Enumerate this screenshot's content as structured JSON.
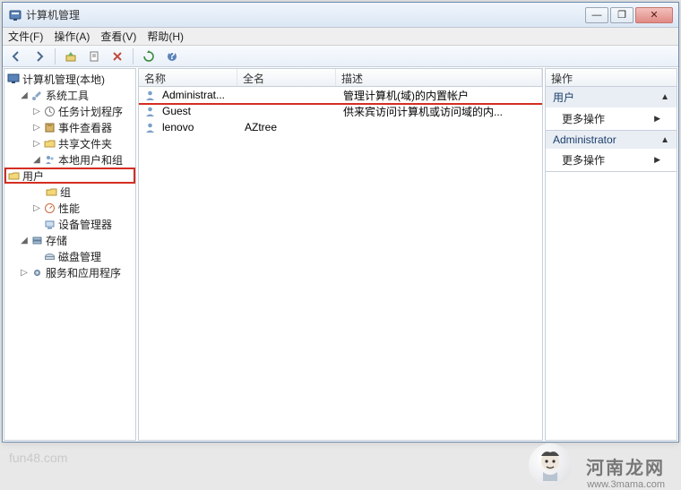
{
  "window": {
    "title": "计算机管理",
    "controls": {
      "min": "—",
      "max": "❐",
      "close": "✕"
    }
  },
  "menu": {
    "file": "文件(F)",
    "action": "操作(A)",
    "view": "查看(V)",
    "help": "帮助(H)"
  },
  "tree": {
    "root": "计算机管理(本地)",
    "system_tools": "系统工具",
    "task_scheduler": "任务计划程序",
    "event_viewer": "事件查看器",
    "shared_folders": "共享文件夹",
    "local_users": "本地用户和组",
    "users": "用户",
    "groups": "组",
    "performance": "性能",
    "device_manager": "设备管理器",
    "storage": "存储",
    "disk_mgmt": "磁盘管理",
    "services_apps": "服务和应用程序"
  },
  "list": {
    "columns": {
      "name": "名称",
      "fullname": "全名",
      "desc": "描述"
    },
    "rows": [
      {
        "name": "Administrat...",
        "fullname": "",
        "desc": "管理计算机(域)的内置帐户"
      },
      {
        "name": "Guest",
        "fullname": "",
        "desc": "供来宾访问计算机或访问域的内..."
      },
      {
        "name": "lenovo",
        "fullname": "AZtree",
        "desc": ""
      }
    ]
  },
  "actions": {
    "header": "操作",
    "section1": {
      "title": "用户",
      "item": "更多操作"
    },
    "section2": {
      "title": "Administrator",
      "item": "更多操作"
    }
  },
  "watermarks": {
    "w1": "fun48.com",
    "w2": "河南龙网",
    "w3": "www.3mama.com"
  }
}
